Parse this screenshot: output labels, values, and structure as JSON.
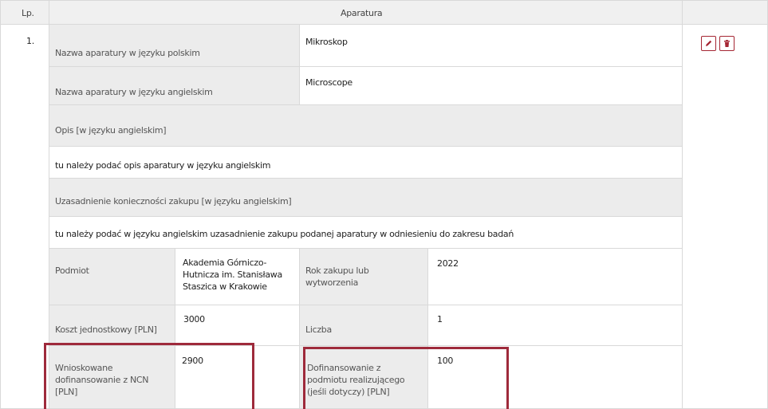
{
  "table": {
    "col_lp": "Lp.",
    "col_main": "Aparatura"
  },
  "row": {
    "number": "1.",
    "name_pl_label": "Nazwa aparatury w języku polskim",
    "name_pl_value": "Mikroskop",
    "name_en_label": "Nazwa aparatury w języku angielskim",
    "name_en_value": "Microscope",
    "desc_label": "Opis [w języku angielskim]",
    "desc_value": "tu należy podać opis aparatury w języku angielskim",
    "justif_label": "Uzasadnienie konieczności zakupu [w języku angielskim]",
    "justif_value": "tu należy podać w języku angielskim uzasadnienie zakupu podanej aparatury w odniesieniu do zakresu badań",
    "entity_label": "Podmiot",
    "entity_value": "Akademia Górniczo-Hutnicza im. Stanisława Staszica w Krakowie",
    "year_label": "Rok zakupu lub wytworzenia",
    "year_value": "2022",
    "unit_cost_label": "Koszt jednostkowy [PLN]",
    "unit_cost_value": "3000",
    "qty_label": "Liczba",
    "qty_value": "1",
    "ncn_label": "Wnioskowane dofinansowanie z NCN [PLN]",
    "ncn_value": "2900",
    "cofin_label": "Dofinansowanie z podmiotu realizującego (jeśli dotyczy) [PLN]",
    "cofin_value": "100"
  },
  "icons": {
    "edit": "pencil-icon",
    "delete": "trash-icon"
  },
  "colors": {
    "accent": "#a52633",
    "highlight": "#9e2a3b",
    "label_bg": "#ececec"
  }
}
